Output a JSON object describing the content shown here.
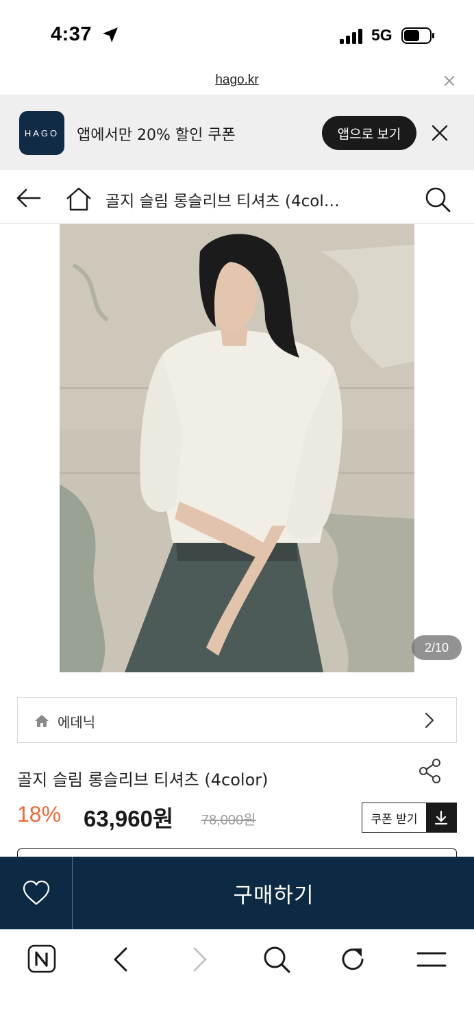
{
  "status_bar": {
    "time": "4:37",
    "network": "5G"
  },
  "url_bar": {
    "domain": "hago.kr"
  },
  "app_banner": {
    "logo_text": "HAGO",
    "message": "앱에서만 20% 할인 쿠폰",
    "open_button": "앱으로 보기"
  },
  "header": {
    "title": "골지 슬림 롱슬리브 티셔츠 (4col…"
  },
  "gallery": {
    "counter": "2/10"
  },
  "brand": {
    "name": "에데닉"
  },
  "product": {
    "name": "골지 슬림 롱슬리브 티셔츠 (4color)",
    "discount": "18%",
    "price": "63,960원",
    "original_price": "78,000원",
    "coupon_button": "쿠폰 받기"
  },
  "purchase_bar": {
    "buy_label": "구매하기"
  },
  "toolbar": {
    "icons": [
      "naver-n-icon",
      "back-arrow-icon",
      "forward-arrow-icon",
      "search-icon",
      "refresh-icon",
      "menu-icon"
    ]
  },
  "colors": {
    "brand_navy": "#0d2a44",
    "discount_orange": "#ee6a36",
    "banner_bg": "#efefef"
  }
}
